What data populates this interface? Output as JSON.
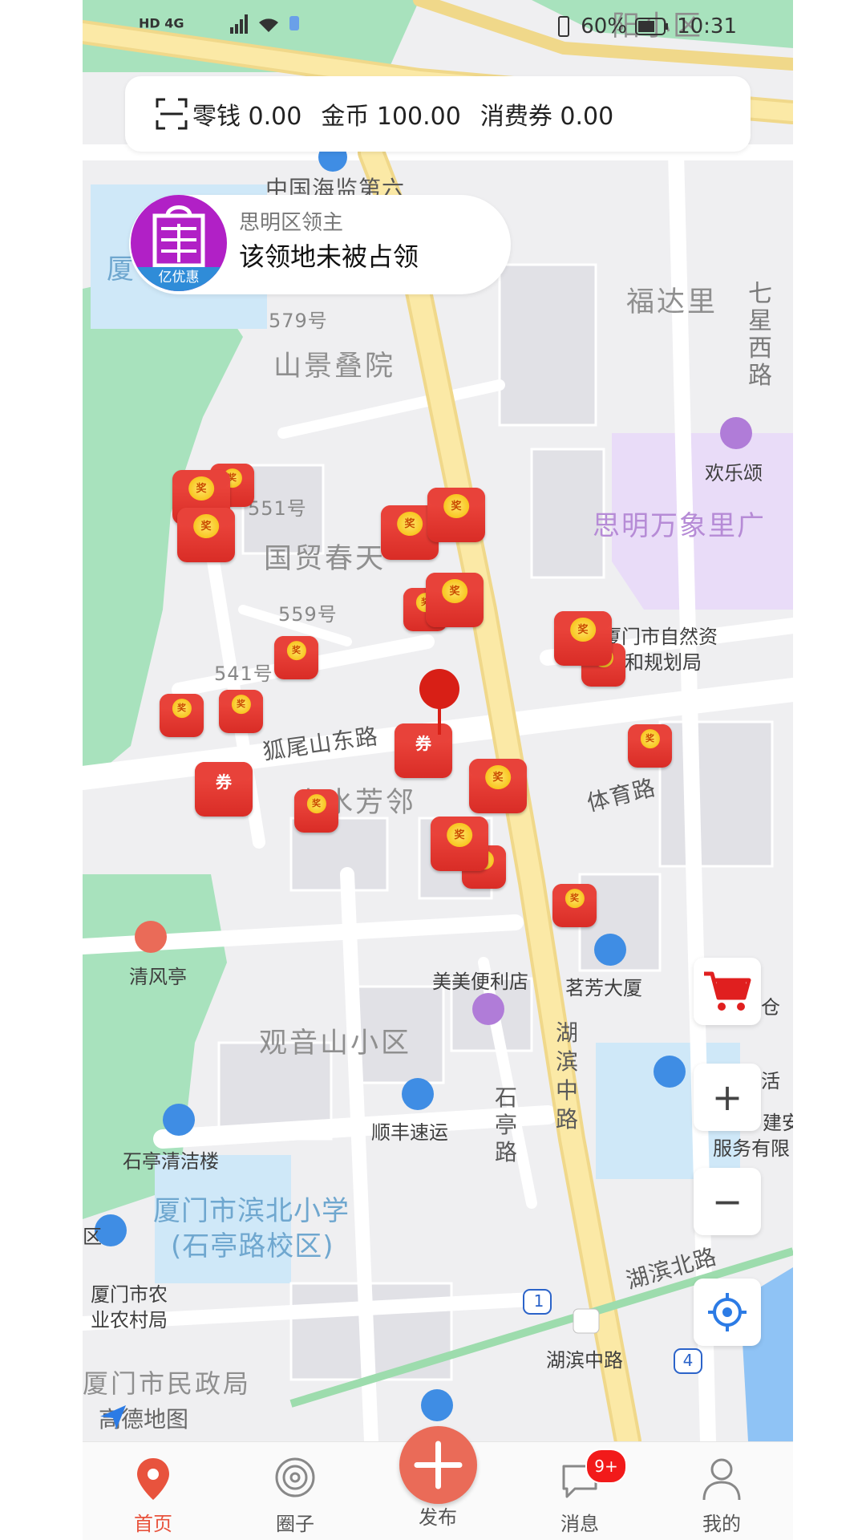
{
  "status_bar": {
    "left_icons": "HD 4G",
    "battery": "60%",
    "time": "10:31"
  },
  "wallet": {
    "change_label": "零钱 0.00",
    "coins_label": "金币 100.00",
    "voucher_label": "消费券 0.00"
  },
  "territory": {
    "logo_text": "亿优惠",
    "title": "思明区领主",
    "status": "该领地未被占领"
  },
  "map": {
    "labels": {
      "community_corner": "阳小区",
      "ocean": "中国海监第六",
      "fudali": "福达里",
      "qixing": "七星西路",
      "no579": "579号",
      "shanjing": "山景叠院",
      "huanlesong": "欢乐颂",
      "wanxiang": "思明万象里广",
      "no551": "551号",
      "guomao": "国贸春天",
      "no559": "559号",
      "ziran1": "厦门市自然资",
      "ziran2": "和规划局",
      "no541": "541号",
      "huwei": "狐尾山东路",
      "shanshui": "山水芳邻",
      "tiyu": "体育路",
      "qingfeng": "清风亭",
      "meimei": "美美便利店",
      "mingfang": "茗芳大厦",
      "guanyin": "观音山小区",
      "hubinzhong": "湖滨中路",
      "shiting_road": "石亭路",
      "shunfeng": "顺丰速运",
      "shiting_clean": "石亭清洁楼",
      "binbei1": "厦门市滨北小学",
      "binbei2": "(石亭路校区)",
      "nongye1": "厦门市农",
      "nongye2": "业农村局",
      "minzheng": "厦门市民政局",
      "hubinbei": "湖滨北路",
      "hubinzhong2": "湖滨中路",
      "jianan1": "建安",
      "jianan2": "服务有限",
      "cang": "仓",
      "huo": "活",
      "sha": "厦",
      "qu": "区",
      "gaode": "高德地图",
      "metro1": "1",
      "metro4": "4"
    },
    "marker_char_reward": "奖",
    "marker_char_voucher": "券"
  },
  "controls": {
    "zoom_in": "+",
    "zoom_out": "−"
  },
  "nav": {
    "home": "首页",
    "circle": "圈子",
    "publish": "发布",
    "messages": "消息",
    "messages_badge": "9+",
    "mine": "我的"
  }
}
